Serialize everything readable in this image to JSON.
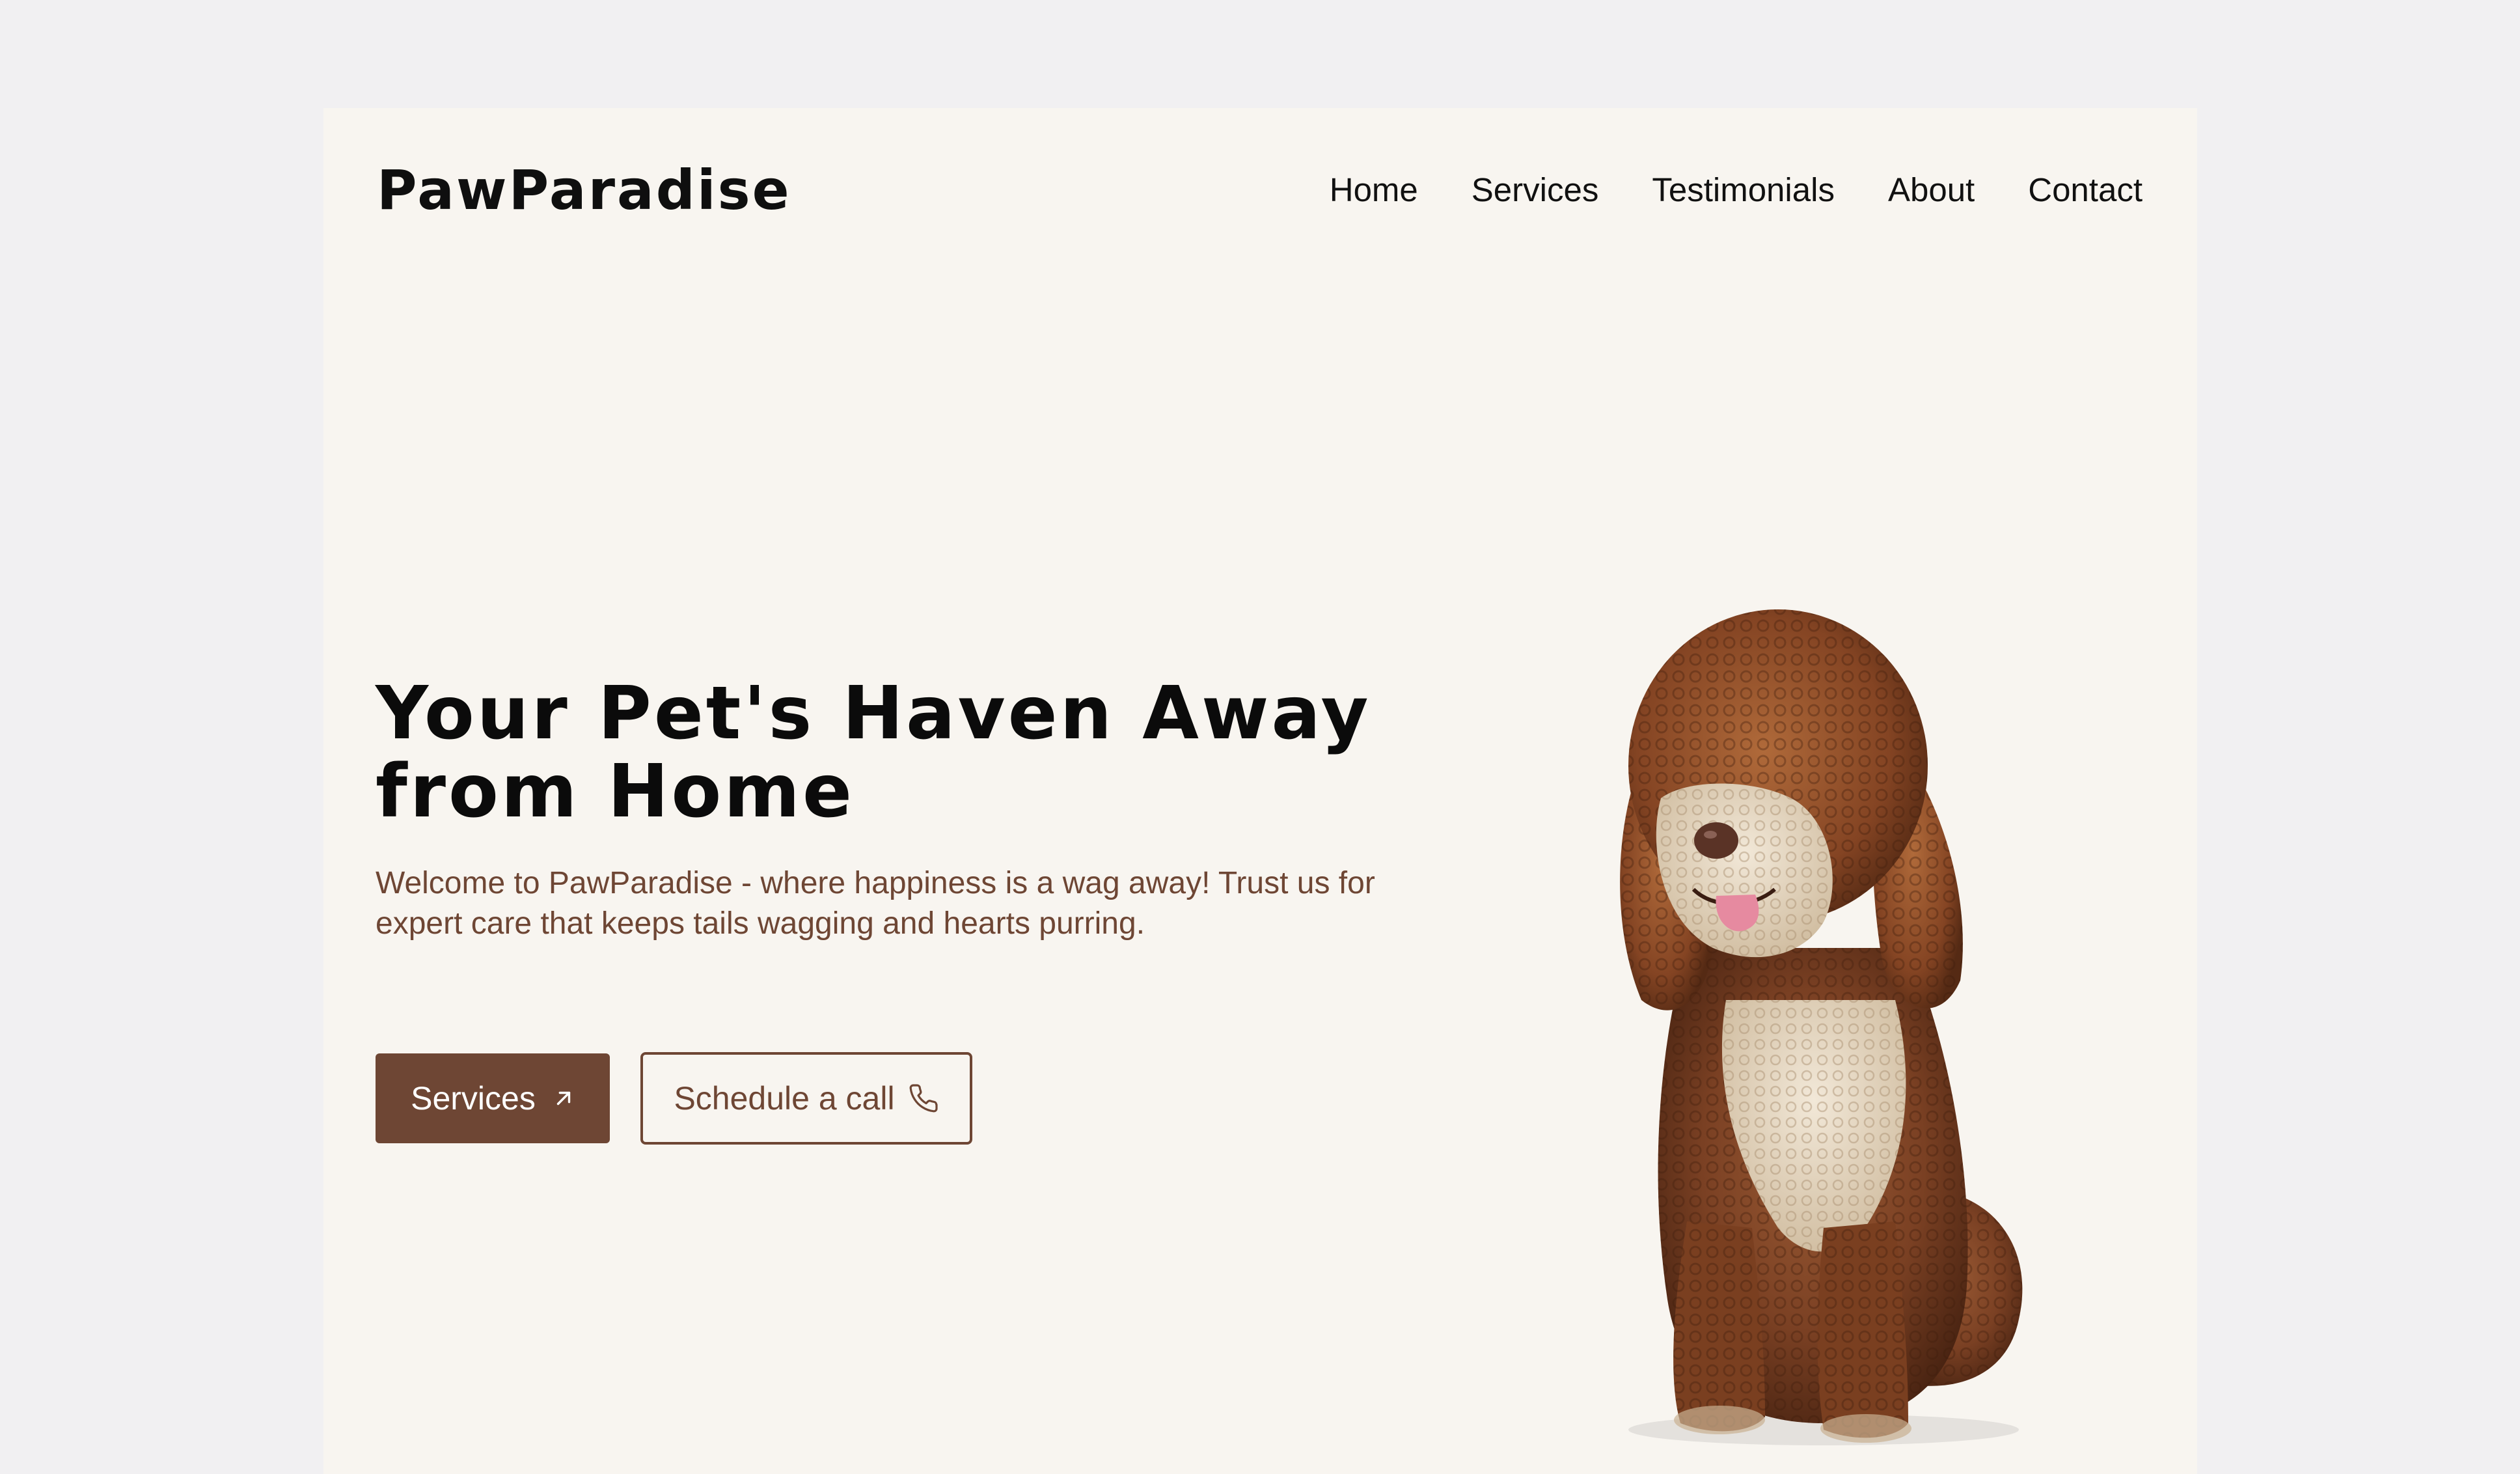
{
  "header": {
    "logo": "PawParadise",
    "nav": [
      {
        "label": "Home"
      },
      {
        "label": "Services"
      },
      {
        "label": "Testimonials"
      },
      {
        "label": "About"
      },
      {
        "label": "Contact"
      }
    ]
  },
  "hero": {
    "title": "Your Pet's Haven Away from Home",
    "subtitle": "Welcome to PawParadise - where happiness is a wag away! Trust us for expert care that keeps tails wagging and hearts purring.",
    "primary_button": {
      "label": "Services",
      "icon": "arrow-up-right-icon"
    },
    "secondary_button": {
      "label": "Schedule a call",
      "icon": "phone-icon"
    }
  },
  "colors": {
    "page_bg": "#f1f0f2",
    "card_bg": "#f8f5f0",
    "brand_brown": "#6e4634",
    "text_dark": "#0b0b0b"
  }
}
